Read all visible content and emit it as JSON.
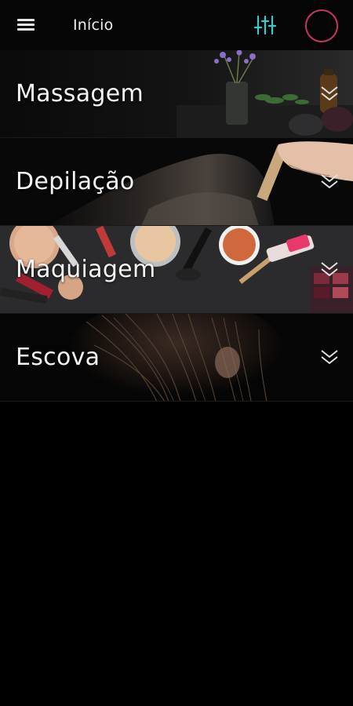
{
  "header": {
    "title": "Início",
    "menu_icon": "hamburger-menu-icon",
    "filter_icon": "sliders-icon",
    "avatar_border_color": "#c8365a",
    "filter_icon_color": "#3fc7c9"
  },
  "categories": [
    {
      "label": "Massagem",
      "image": "massage-spa-photo"
    },
    {
      "label": "Depilação",
      "image": "waxing-photo"
    },
    {
      "label": "Maquiagem",
      "image": "makeup-products-photo"
    },
    {
      "label": "Escova",
      "image": "hair-photo"
    }
  ],
  "chevron_icon": "double-chevron-down-icon"
}
